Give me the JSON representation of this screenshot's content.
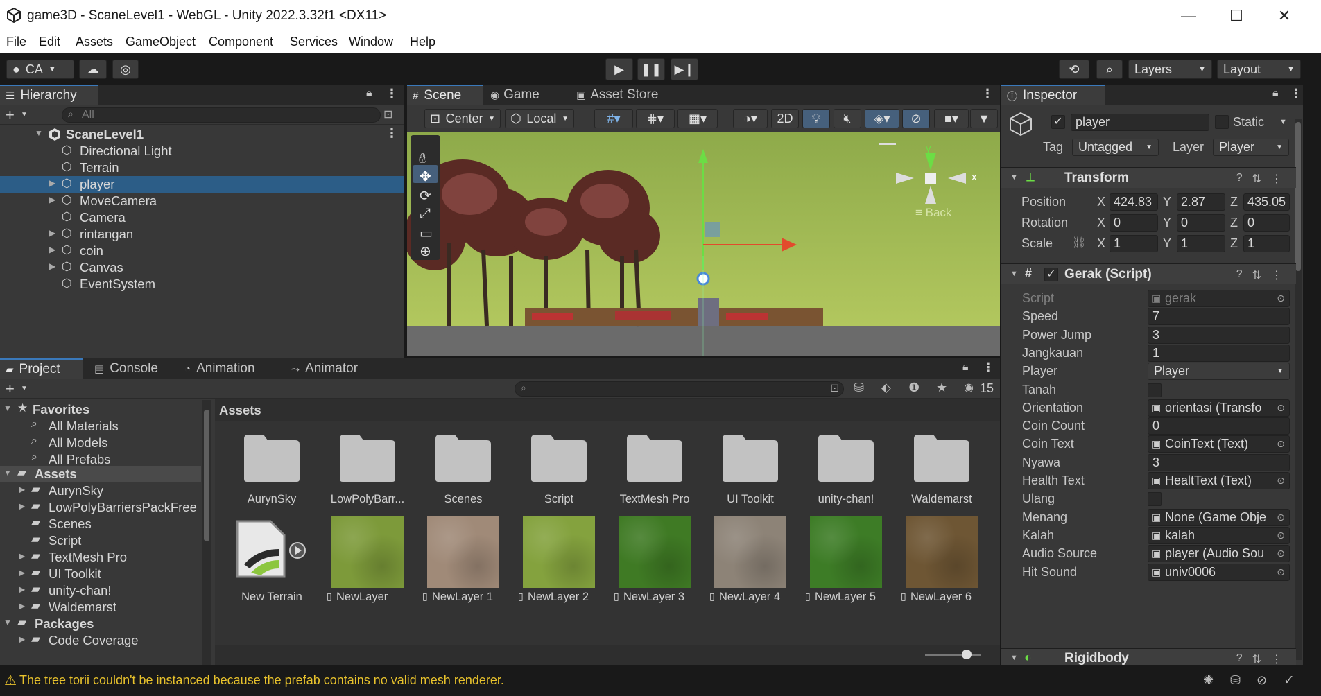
{
  "window": {
    "title": "game3D - ScaneLevel1 - WebGL - Unity 2022.3.32f1 <DX11>",
    "minimize": "—",
    "maximize": "☐",
    "close": "✕"
  },
  "menu": [
    "File",
    "Edit",
    "Assets",
    "GameObject",
    "Component",
    "Services",
    "Window",
    "Help"
  ],
  "toolbar": {
    "account": "CA",
    "layers": "Layers",
    "layout": "Layout"
  },
  "hierarchy": {
    "tab": "Hierarchy",
    "search_placeholder": "All",
    "scene": "ScaneLevel1",
    "items": [
      {
        "label": "Directional Light",
        "expandable": false
      },
      {
        "label": "Terrain",
        "expandable": false
      },
      {
        "label": "player",
        "expandable": true,
        "selected": true
      },
      {
        "label": "MoveCamera",
        "expandable": true
      },
      {
        "label": "Camera",
        "expandable": false
      },
      {
        "label": "rintangan",
        "expandable": true
      },
      {
        "label": "coin",
        "expandable": true
      },
      {
        "label": "Canvas",
        "expandable": true
      },
      {
        "label": "EventSystem",
        "expandable": false
      }
    ]
  },
  "scene_view": {
    "tabs": [
      "Scene",
      "Game",
      "Asset Store"
    ],
    "pivot": "Center",
    "space": "Local",
    "mode_2d": "2D",
    "gizmo_y": "y",
    "gizmo_x": "x",
    "gizmo_label": "≡ Back"
  },
  "inspector": {
    "tab": "Inspector",
    "object_name": "player",
    "static_label": "Static",
    "tag_label": "Tag",
    "tag_value": "Untagged",
    "layer_label": "Layer",
    "layer_value": "Player",
    "transform": {
      "title": "Transform",
      "position_label": "Position",
      "rotation_label": "Rotation",
      "scale_label": "Scale",
      "position": {
        "x": "424.83",
        "y": "2.87",
        "z": "435.05"
      },
      "rotation": {
        "x": "0",
        "y": "0",
        "z": "0"
      },
      "scale": {
        "x": "1",
        "y": "1",
        "z": "1"
      }
    },
    "script": {
      "title": "Gerak (Script)",
      "fields": [
        {
          "label": "Script",
          "value": "gerak",
          "kind": "object-disabled"
        },
        {
          "label": "Speed",
          "value": "7",
          "kind": "text"
        },
        {
          "label": "Power Jump",
          "value": "3",
          "kind": "text"
        },
        {
          "label": "Jangkauan",
          "value": "1",
          "kind": "text"
        },
        {
          "label": "Player",
          "value": "Player",
          "kind": "dropdown"
        },
        {
          "label": "Tanah",
          "value": "",
          "kind": "checkbox"
        },
        {
          "label": "Orientation",
          "value": "orientasi (Transfo",
          "kind": "object"
        },
        {
          "label": "Coin Count",
          "value": "0",
          "kind": "text"
        },
        {
          "label": "Coin Text",
          "value": "CoinText (Text)",
          "kind": "object"
        },
        {
          "label": "Nyawa",
          "value": "3",
          "kind": "text"
        },
        {
          "label": "Health Text",
          "value": "HealtText (Text)",
          "kind": "object"
        },
        {
          "label": "Ulang",
          "value": "",
          "kind": "checkbox"
        },
        {
          "label": "Menang",
          "value": "None (Game Obje",
          "kind": "object"
        },
        {
          "label": "Kalah",
          "value": "kalah",
          "kind": "object"
        },
        {
          "label": "Audio Source",
          "value": "player (Audio Sou",
          "kind": "object"
        },
        {
          "label": "Hit Sound",
          "value": "univ0006",
          "kind": "object"
        }
      ]
    },
    "rigidbody": {
      "title": "Rigidbody"
    }
  },
  "project": {
    "tabs": [
      "Project",
      "Console",
      "Animation",
      "Animator"
    ],
    "count": "15",
    "breadcrumb": "Assets",
    "favorites": {
      "label": "Favorites",
      "items": [
        "All Materials",
        "All Models",
        "All Prefabs"
      ]
    },
    "tree": {
      "assets_label": "Assets",
      "items": [
        {
          "label": "AurynSky",
          "expandable": true
        },
        {
          "label": "LowPolyBarriersPackFree",
          "expandable": true
        },
        {
          "label": "Scenes",
          "expandable": false
        },
        {
          "label": "Script",
          "expandable": false
        },
        {
          "label": "TextMesh Pro",
          "expandable": true
        },
        {
          "label": "UI Toolkit",
          "expandable": true
        },
        {
          "label": "unity-chan!",
          "expandable": true
        },
        {
          "label": "Waldemarst",
          "expandable": true
        }
      ],
      "packages_label": "Packages",
      "package_items": [
        "Code Coverage"
      ]
    },
    "folders": [
      "AurynSky",
      "LowPolyBarr...",
      "Scenes",
      "Script",
      "TextMesh Pro",
      "UI Toolkit",
      "unity-chan!",
      "Waldemarst"
    ],
    "files": [
      {
        "label": "New Terrain",
        "kind": "terrain",
        "color": "#e8e8e8"
      },
      {
        "label": "NewLayer",
        "kind": "texture",
        "color": "#7d9a3a"
      },
      {
        "label": "NewLayer 1",
        "kind": "texture",
        "color": "#a08a78"
      },
      {
        "label": "NewLayer 2",
        "kind": "texture",
        "color": "#84a23e"
      },
      {
        "label": "NewLayer 3",
        "kind": "texture",
        "color": "#3f7a24"
      },
      {
        "label": "NewLayer 4",
        "kind": "texture",
        "color": "#8d8377"
      },
      {
        "label": "NewLayer 5",
        "kind": "texture",
        "color": "#3d7c26"
      },
      {
        "label": "NewLayer 6",
        "kind": "texture",
        "color": "#6e5634"
      }
    ]
  },
  "status": {
    "message": "The tree torii couldn't be instanced because the prefab contains no valid mesh renderer."
  },
  "colors": {
    "accent": "#2c5d87",
    "panel": "#383838",
    "warning": "#e8c22c"
  }
}
